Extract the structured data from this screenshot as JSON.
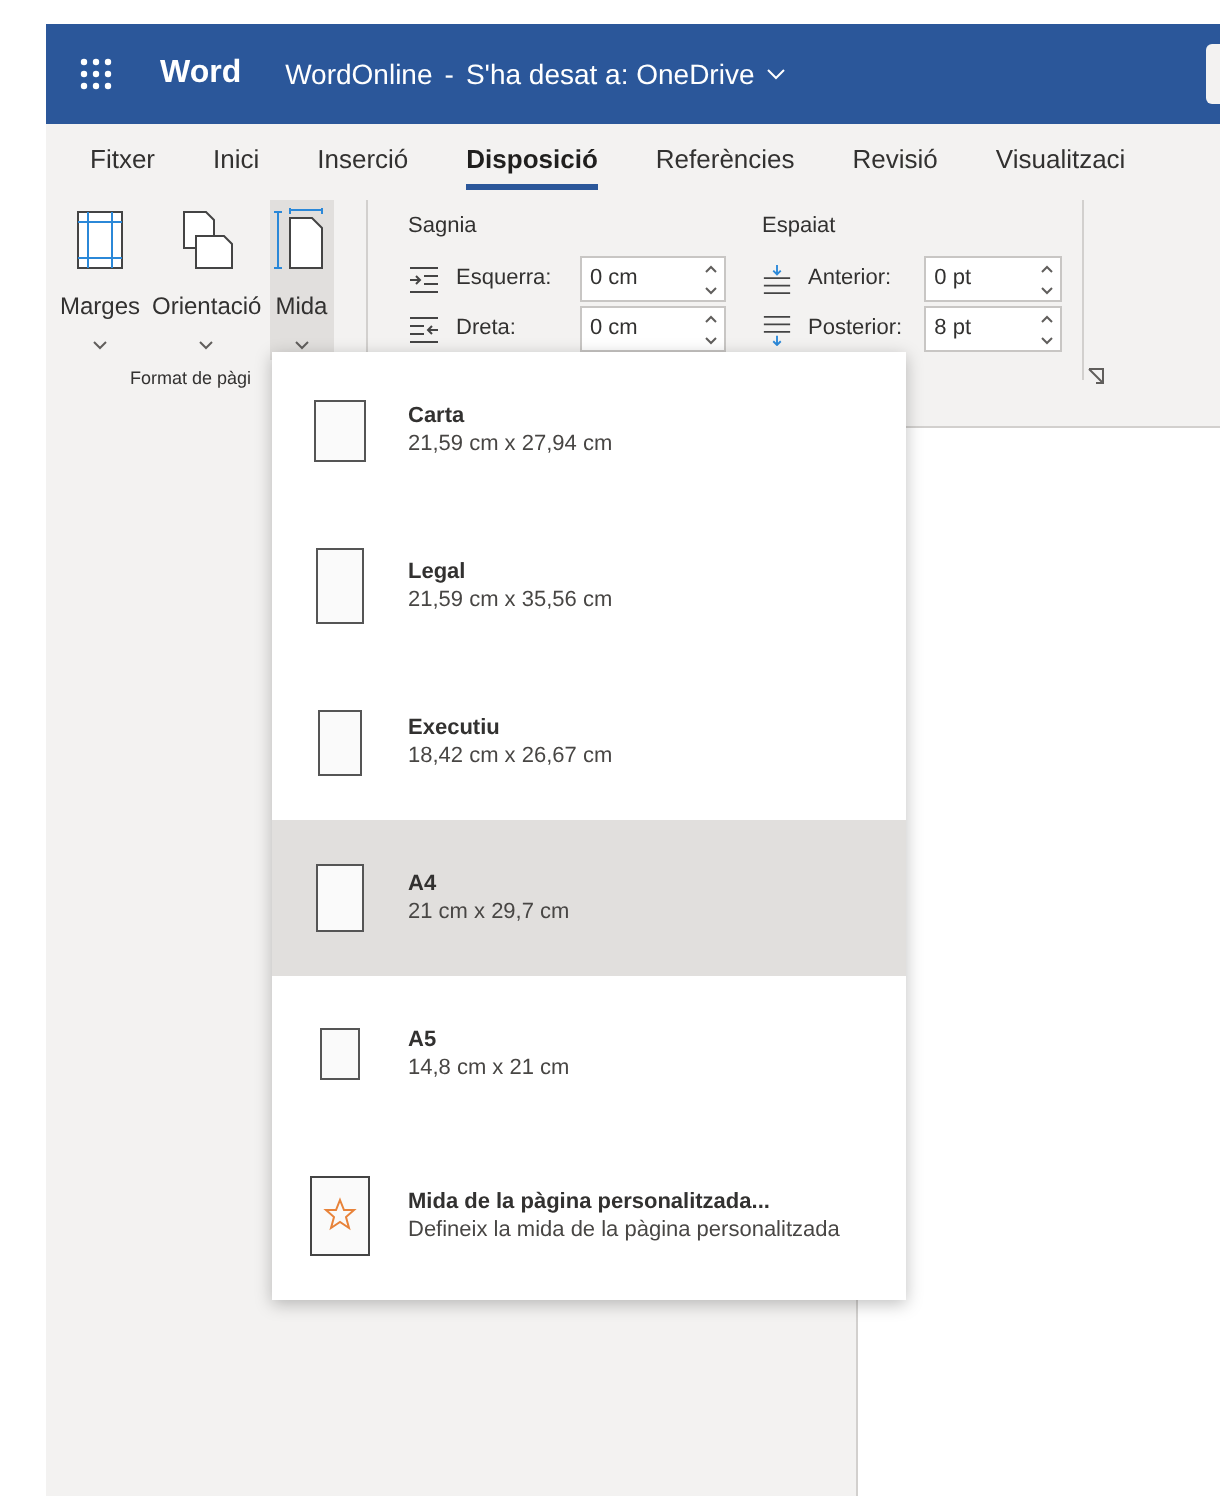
{
  "header": {
    "app_name": "Word",
    "document": "WordOnline",
    "separator": "-",
    "save_status": "S'ha desat a: OneDrive"
  },
  "tabs": [
    {
      "label": "Fitxer",
      "selected": false
    },
    {
      "label": "Inici",
      "selected": false
    },
    {
      "label": "Inserció",
      "selected": false
    },
    {
      "label": "Disposició",
      "selected": true
    },
    {
      "label": "Referències",
      "selected": false
    },
    {
      "label": "Revisió",
      "selected": false
    },
    {
      "label": "Visualitzaci",
      "selected": false
    }
  ],
  "ribbon": {
    "page_setup": {
      "label": "Format de pàgi",
      "buttons": [
        {
          "kind": "margins",
          "label": "Marges",
          "selected": false
        },
        {
          "kind": "orientation",
          "label": "Orientació",
          "selected": false
        },
        {
          "kind": "size",
          "label": "Mida",
          "selected": true
        }
      ]
    },
    "indent": {
      "title": "Sagnia",
      "fields": [
        {
          "kind": "left",
          "label": "Esquerra:",
          "value": "0 cm"
        },
        {
          "kind": "right",
          "label": "Dreta:",
          "value": "0 cm"
        }
      ]
    },
    "spacing": {
      "title": "Espaiat",
      "fields": [
        {
          "kind": "before",
          "label": "Anterior:",
          "value": "0 pt"
        },
        {
          "kind": "after",
          "label": "Posterior:",
          "value": "8 pt"
        }
      ]
    }
  },
  "size_menu": [
    {
      "kind": "letter",
      "name": "Carta",
      "size": "21,59 cm x 27,94 cm",
      "selected": false
    },
    {
      "kind": "legal",
      "name": "Legal",
      "size": "21,59 cm x 35,56 cm",
      "selected": false
    },
    {
      "kind": "executive",
      "name": "Executiu",
      "size": "18,42 cm x 26,67 cm",
      "selected": false
    },
    {
      "kind": "a4",
      "name": "A4",
      "size": "21 cm x 29,7 cm",
      "selected": true
    },
    {
      "kind": "a5",
      "name": "A5",
      "size": "14,8 cm x 21 cm",
      "selected": false
    },
    {
      "kind": "custom",
      "name": "Mida de la pàgina personalitzada...",
      "size": "Defineix la mida de la pàgina personalitzada",
      "selected": false
    }
  ]
}
